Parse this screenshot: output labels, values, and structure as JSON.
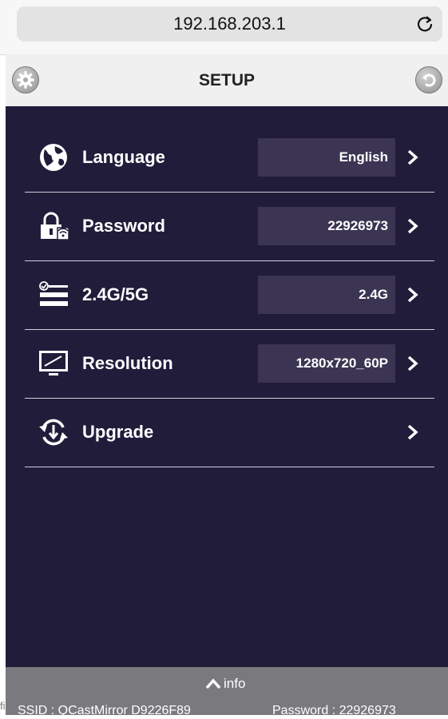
{
  "browser": {
    "url": "192.168.203.1",
    "reload_icon": "reload-icon"
  },
  "header": {
    "title": "SETUP",
    "left_icon": "gear-icon",
    "right_icon": "back-icon"
  },
  "items": [
    {
      "label": "Language",
      "value": "English",
      "icon": "globe-icon"
    },
    {
      "label": "Password",
      "value": "22926973",
      "icon": "lock-icon"
    },
    {
      "label": "2.4G/5G",
      "value": "2.4G",
      "icon": "wifi-band-icon"
    },
    {
      "label": "Resolution",
      "value": "1280x720_60P",
      "icon": "monitor-icon"
    },
    {
      "label": "Upgrade",
      "value": "",
      "icon": "upgrade-icon"
    }
  ],
  "footer": {
    "info_label": "info",
    "ssid": "SSID : QCastMirror D9226F89",
    "password": "Password : 22926973",
    "stub": "fi"
  },
  "colors": {
    "panel": "#221c3b",
    "value_box": "#3b3553",
    "footer": "#7a7a7e"
  }
}
